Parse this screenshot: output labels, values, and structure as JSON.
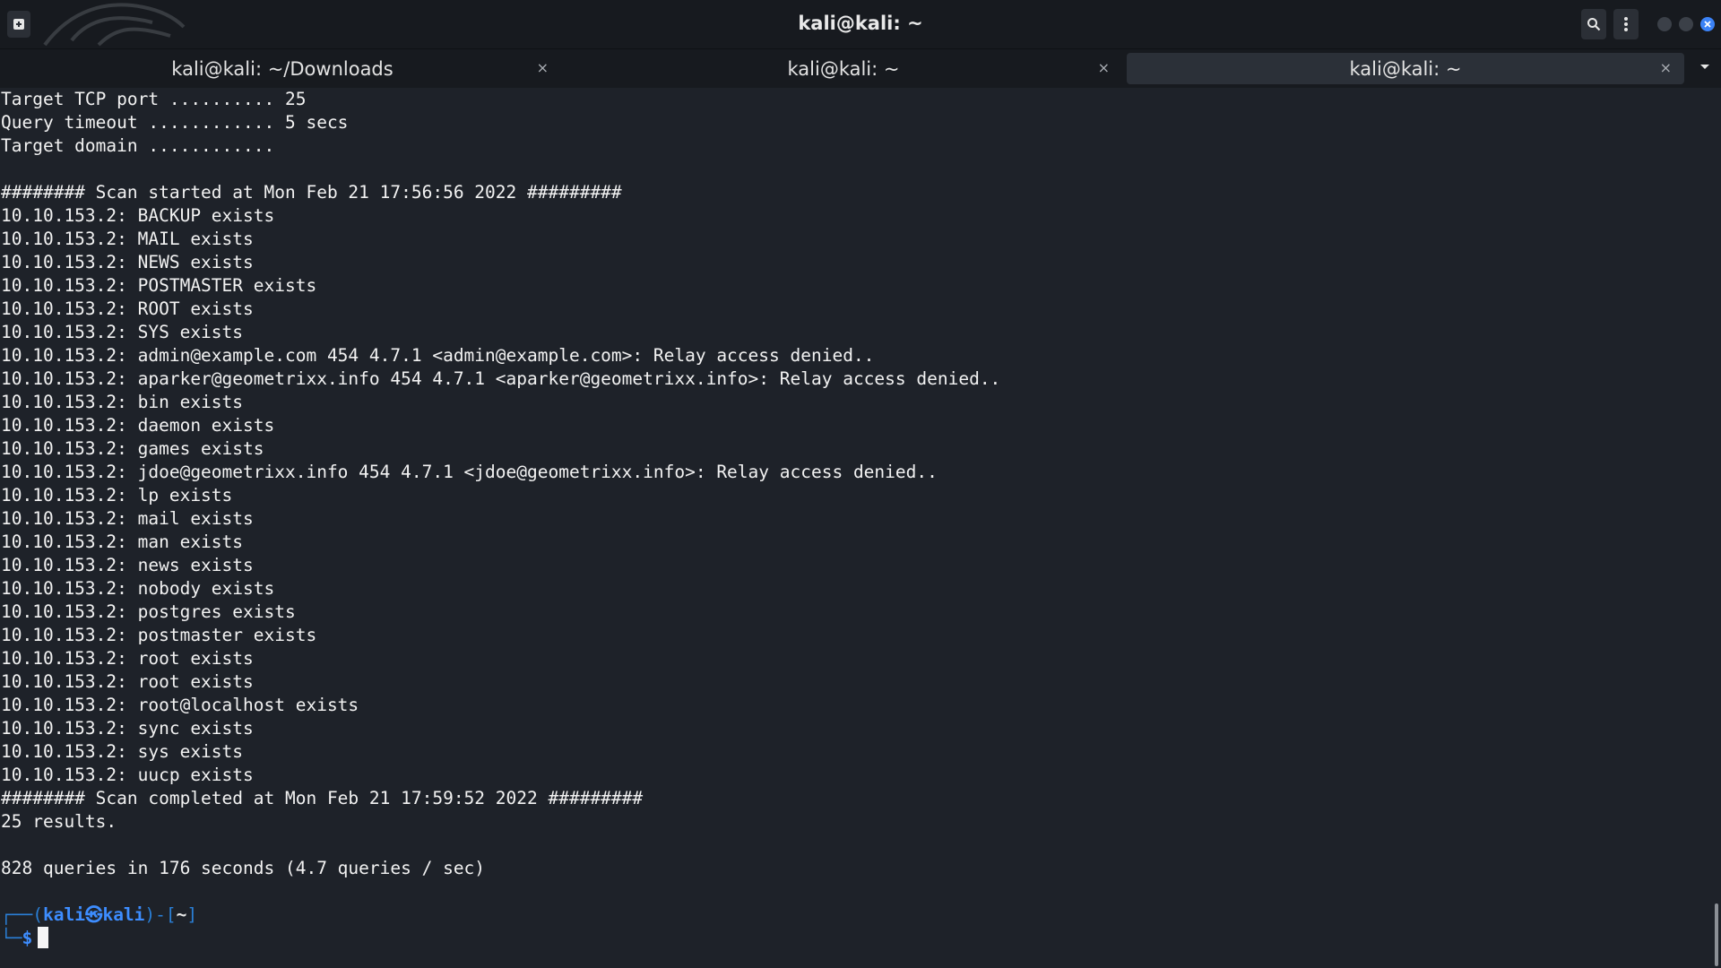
{
  "window": {
    "title": "kali@kali: ~"
  },
  "tabs": [
    {
      "label": "kali@kali: ~/Downloads",
      "active": false
    },
    {
      "label": "kali@kali: ~",
      "active": false
    },
    {
      "label": "kali@kali: ~",
      "active": true
    }
  ],
  "tab_close_glyph": "×",
  "terminal": {
    "lines": [
      "Target TCP port .......... 25",
      "Query timeout ............ 5 secs",
      "Target domain ............",
      "",
      "######## Scan started at Mon Feb 21 17:56:56 2022 #########",
      "10.10.153.2: BACKUP exists",
      "10.10.153.2: MAIL exists",
      "10.10.153.2: NEWS exists",
      "10.10.153.2: POSTMASTER exists",
      "10.10.153.2: ROOT exists",
      "10.10.153.2: SYS exists",
      "10.10.153.2: admin@example.com 454 4.7.1 <admin@example.com>: Relay access denied..",
      "10.10.153.2: aparker@geometrixx.info 454 4.7.1 <aparker@geometrixx.info>: Relay access denied..",
      "10.10.153.2: bin exists",
      "10.10.153.2: daemon exists",
      "10.10.153.2: games exists",
      "10.10.153.2: jdoe@geometrixx.info 454 4.7.1 <jdoe@geometrixx.info>: Relay access denied..",
      "10.10.153.2: lp exists",
      "10.10.153.2: mail exists",
      "10.10.153.2: man exists",
      "10.10.153.2: news exists",
      "10.10.153.2: nobody exists",
      "10.10.153.2: postgres exists",
      "10.10.153.2: postmaster exists",
      "10.10.153.2: root exists",
      "10.10.153.2: root exists",
      "10.10.153.2: root@localhost exists",
      "10.10.153.2: sync exists",
      "10.10.153.2: sys exists",
      "10.10.153.2: uucp exists",
      "######## Scan completed at Mon Feb 21 17:59:52 2022 #########",
      "25 results.",
      "",
      "828 queries in 176 seconds (4.7 queries / sec)",
      ""
    ],
    "prompt": {
      "line1_prefix": "┌──(",
      "user": "kali",
      "at": "㉿",
      "host": "kali",
      "mid": ")-[",
      "dir": "~",
      "line1_suffix": "]",
      "line2_prefix": "└─",
      "dollar": "$"
    }
  },
  "colors": {
    "background": "#1e2229",
    "prompt_blue": "#3d8dff",
    "close_button": "#3b82f6"
  },
  "icons": [
    "new-tab-icon",
    "search-icon",
    "kebab-menu-icon",
    "minimize-icon",
    "maximize-icon",
    "close-icon",
    "tab-list-dropdown-icon",
    "kali-dragon-logo"
  ]
}
